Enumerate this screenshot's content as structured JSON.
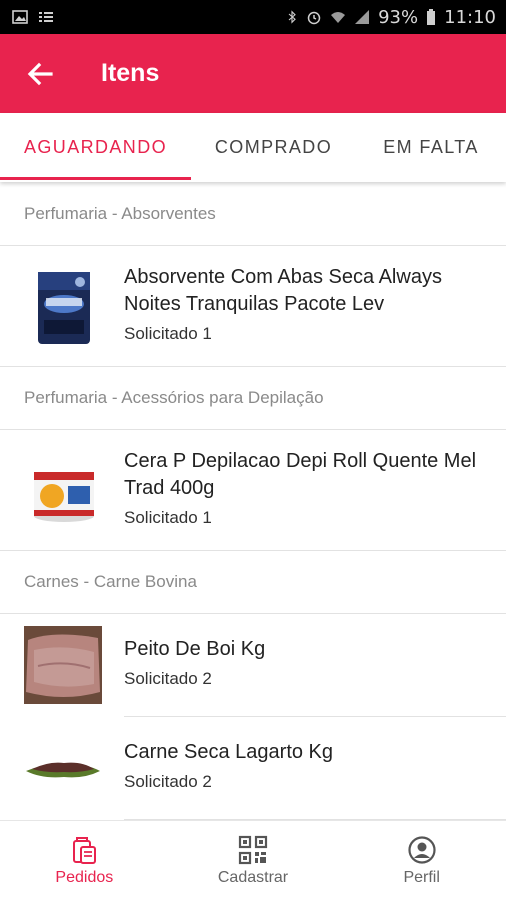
{
  "status_bar": {
    "battery": "93%",
    "time": "11:10"
  },
  "app_bar": {
    "title": "Itens",
    "back_icon": "arrow-back-icon"
  },
  "tabs": [
    {
      "label": "AGUARDANDO",
      "active": true
    },
    {
      "label": "COMPRADO",
      "active": false
    },
    {
      "label": "EM FALTA",
      "active": false
    }
  ],
  "sections": [
    {
      "header": "Perfumaria - Absorventes",
      "items": [
        {
          "name": "Absorvente Com Abas Seca Always Noites Tranquilas Pacote Lev",
          "qty": "Solicitado 1"
        }
      ]
    },
    {
      "header": "Perfumaria - Acessórios para Depilação",
      "items": [
        {
          "name": "Cera P Depilacao Depi Roll Quente Mel Trad 400g",
          "qty": "Solicitado 1"
        }
      ]
    },
    {
      "header": "Carnes - Carne Bovina",
      "items": [
        {
          "name": "Peito De Boi Kg",
          "qty": "Solicitado 2"
        },
        {
          "name": "Carne Seca Lagarto Kg",
          "qty": "Solicitado 2"
        }
      ]
    }
  ],
  "bottom_nav": [
    {
      "label": "Pedidos",
      "icon": "orders-icon",
      "active": true
    },
    {
      "label": "Cadastrar",
      "icon": "qr-code-icon",
      "active": false
    },
    {
      "label": "Perfil",
      "icon": "profile-icon",
      "active": false
    }
  ],
  "colors": {
    "primary": "#e8234e",
    "status_bar": "#000000"
  }
}
